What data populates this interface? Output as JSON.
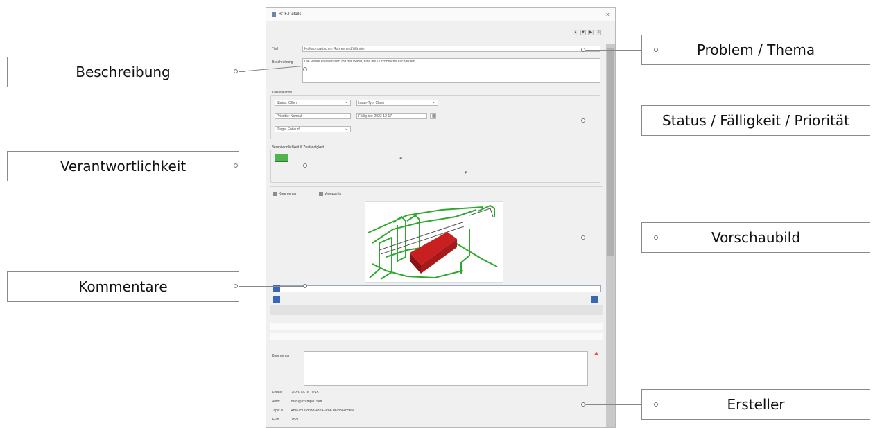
{
  "callouts": {
    "problem": "Problem / Thema",
    "beschreibung": "Beschreibung",
    "status": "Status / Fälligkeit / Priorität",
    "verantwortlich": "Verantwortlichkeit",
    "vorschau": "Vorschaubild",
    "kommentare": "Kommentare",
    "ersteller": "Ersteller"
  },
  "panel": {
    "title": "BCF-Details",
    "close_icon": "close-icon",
    "toolbar_icons": [
      "arrow-up-icon",
      "arrow-down-icon",
      "arrow-right-icon",
      "list-icon"
    ],
    "fields": {
      "title_label": "Titel",
      "title_value": "Kollision zwischen Rohren und Wänden",
      "description_label": "Beschreibung",
      "description_value": "Die Rohre kreuzen sich mit der Wand, bitte die Durchbrüche nachprüfen",
      "classification_label": "Klassifikation",
      "status_value": "Status: Offen",
      "type_value": "Issue-Typ: Clash",
      "due_label": "Fällig bis: 2023-12-17",
      "priority_value": "Priorität: Normal",
      "stage_value": "Stage: Entwurf",
      "responsible_label": "Verantwortlichkeit & Zuständigkeit"
    },
    "tabs": [
      "Kommentar",
      "Viewpoints"
    ],
    "comment_label": "Kommentar",
    "info": [
      {
        "label": "Erstellt",
        "value": "2023-12-16 10:45"
      },
      {
        "label": "Autor",
        "value": "max@example.com"
      },
      {
        "label": "Topic ID",
        "value": "4f9a2c1e-8b3d-4d2a-9c6f-1a2b3c4d5e6f"
      },
      {
        "label": "Guid",
        "value": "7c21"
      }
    ]
  },
  "colors": {
    "callout_border": "#8a8a8a",
    "accent_blue": "#3a67b4",
    "preview_green": "#2ea82e",
    "preview_red": "#c82020"
  }
}
